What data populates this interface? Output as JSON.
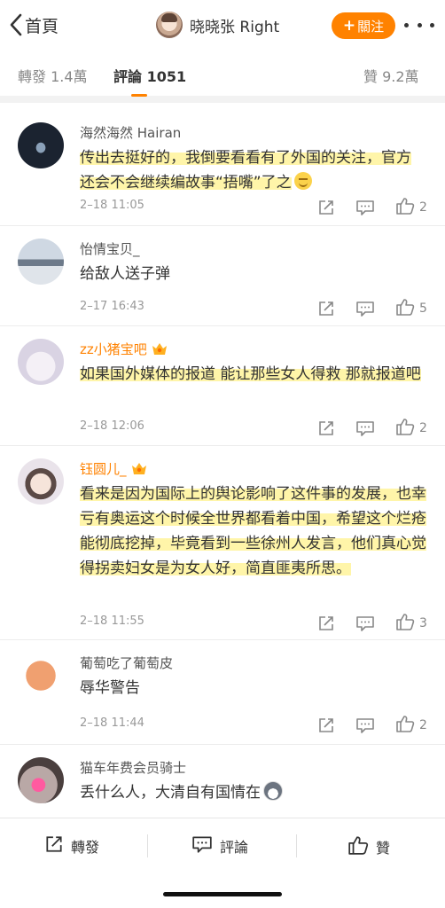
{
  "header": {
    "back_label": "首頁",
    "title": "晓晓张 Right",
    "follow_label": "關注",
    "follow_plus": "+"
  },
  "tabs": [
    {
      "label": "轉發 1.4萬",
      "active": false
    },
    {
      "label": "評論 1051",
      "active": true
    },
    {
      "label": "贊 9.2萬",
      "active": false
    }
  ],
  "comments": [
    {
      "user": "海然海然 Hairan",
      "text": "传出去挺好的，我倒要看看有了外国的关注，官方还会不会继续编故事“捂嘴”了之",
      "emoji": "smile-emoji",
      "time": "2–18 11:05",
      "likes": "2"
    },
    {
      "user": "怡情宝贝_",
      "text": "给敌人送子弹",
      "time": "2–17 16:43",
      "likes": "5"
    },
    {
      "user": "zz小猪宝吧",
      "text": "如果国外媒体的报道 能让那些女人得救 那就报道吧",
      "time": "2–18 12:06",
      "likes": "2",
      "vip": true
    },
    {
      "user": "钰圆儿_",
      "text": "看来是因为国际上的舆论影响了这件事的发展，也幸亏有奥运这个时候全世界都看着中国，希望这个烂疮能彻底挖掉，毕竟看到一些徐州人发言，他们真心觉得拐卖妇女是为女人好，简直匪夷所思。",
      "time": "2–18 11:55",
      "likes": "3",
      "vip": true
    },
    {
      "user": "葡萄吃了葡萄皮",
      "text": "辱华警告",
      "time": "2–18 11:44",
      "likes": "2"
    },
    {
      "user": "猫车年费会员骑士",
      "text": "丢什么人，大清自有国情在",
      "emoji": "husky-emoji"
    }
  ],
  "bottom": {
    "repost_label": "轉發",
    "comment_label": "評論",
    "like_label": "贊"
  },
  "colors": {
    "accent": "#ff8200",
    "highlight": "#fff28c",
    "vip_name": "#ff8200"
  }
}
